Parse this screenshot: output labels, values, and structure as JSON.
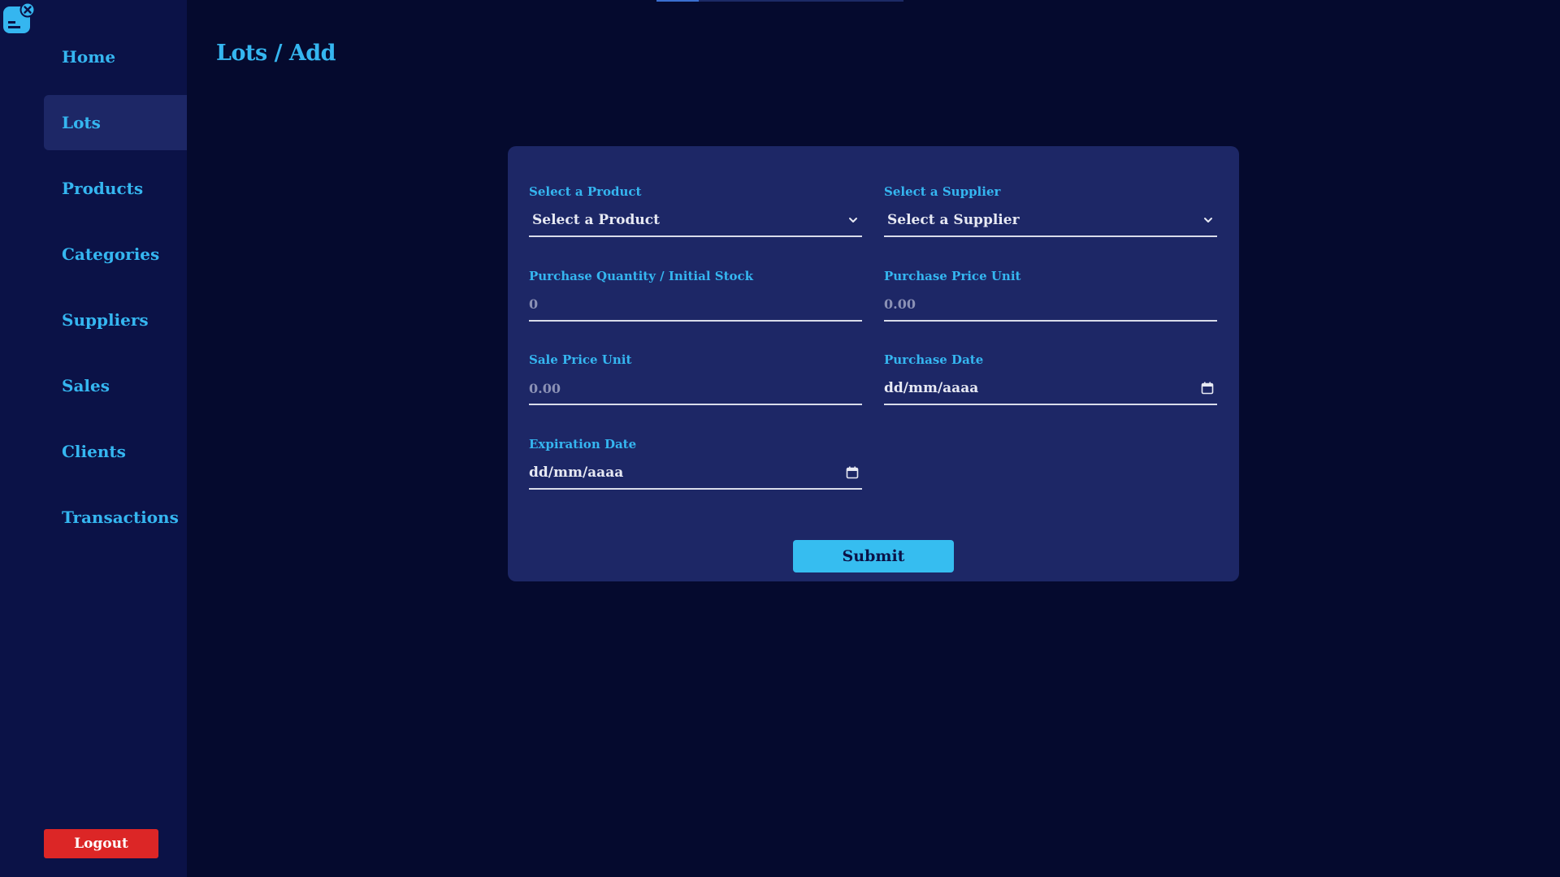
{
  "top_progress": {
    "fraction": 0.17
  },
  "sidebar": {
    "toggle_icon": "close-sidebar-icon",
    "items": [
      {
        "label": "Home",
        "active": false
      },
      {
        "label": "Lots",
        "active": true
      },
      {
        "label": "Products",
        "active": false
      },
      {
        "label": "Categories",
        "active": false
      },
      {
        "label": "Suppliers",
        "active": false
      },
      {
        "label": "Sales",
        "active": false
      },
      {
        "label": "Clients",
        "active": false
      },
      {
        "label": "Transactions",
        "active": false
      }
    ],
    "logout_label": "Logout"
  },
  "page": {
    "title": "Lots / Add"
  },
  "form": {
    "product": {
      "label": "Select a Product",
      "value": "Select a Product",
      "icon": "chevron-down-icon"
    },
    "supplier": {
      "label": "Select a Supplier",
      "value": "Select a Supplier",
      "icon": "chevron-down-icon"
    },
    "quantity": {
      "label": "Purchase Quantity / Initial Stock",
      "placeholder": "0"
    },
    "purchase_price": {
      "label": "Purchase Price Unit",
      "placeholder": "0.00"
    },
    "sale_price": {
      "label": "Sale Price Unit",
      "placeholder": "0.00"
    },
    "purchase_date": {
      "label": "Purchase Date",
      "value": "dd/mm/aaaa",
      "icon": "calendar-icon"
    },
    "expiration_date": {
      "label": "Expiration Date",
      "value": "dd/mm/aaaa",
      "icon": "calendar-icon"
    },
    "submit_label": "Submit"
  },
  "colors": {
    "background": "#050a2e",
    "sidebar": "#0b1247",
    "card": "#1d2766",
    "accent": "#35b6f0",
    "danger": "#dc2626"
  }
}
